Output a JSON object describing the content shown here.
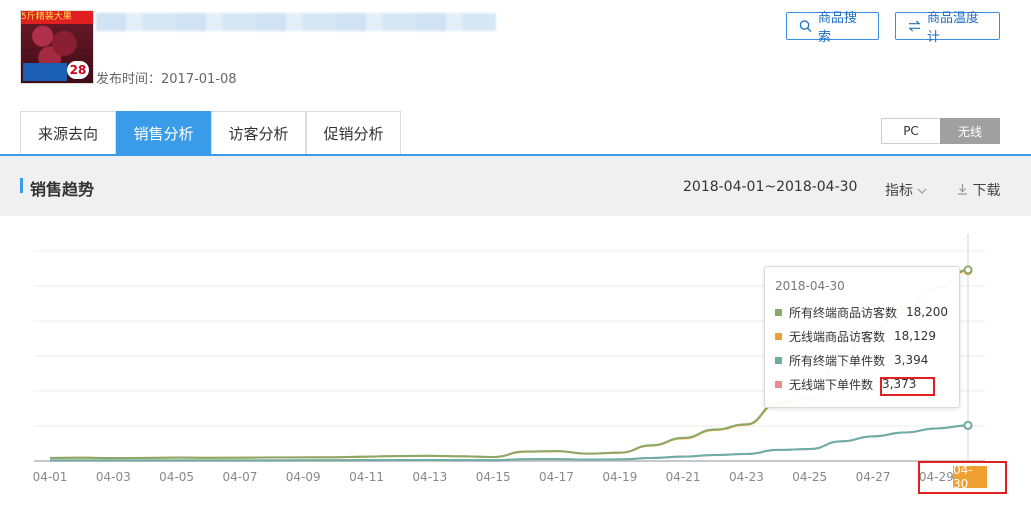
{
  "product": {
    "image_banner_text": "5斤精装大果",
    "image_price": "28",
    "published_label": "发布时间：",
    "published_date": "2017-01-08"
  },
  "toolbar": {
    "search_label": "商品搜索",
    "thermometer_label": "商品温度计"
  },
  "tabs": [
    {
      "label": "来源去向",
      "active": false
    },
    {
      "label": "销售分析",
      "active": true
    },
    {
      "label": "访客分析",
      "active": false
    },
    {
      "label": "促销分析",
      "active": false
    }
  ],
  "device_toggle": {
    "pc_label": "PC",
    "wireless_label": "无线",
    "selected": "无线"
  },
  "section": {
    "title": "销售趋势",
    "date_range": "2018-04-01~2018-04-30",
    "date_ghost": "",
    "metric_label": "指标",
    "download_label": "下载"
  },
  "chart_data": {
    "type": "line",
    "x": [
      "04-01",
      "04-02",
      "04-03",
      "04-04",
      "04-05",
      "04-06",
      "04-07",
      "04-08",
      "04-09",
      "04-10",
      "04-11",
      "04-12",
      "04-13",
      "04-14",
      "04-15",
      "04-16",
      "04-17",
      "04-18",
      "04-19",
      "04-20",
      "04-21",
      "04-22",
      "04-23",
      "04-24",
      "04-25",
      "04-26",
      "04-27",
      "04-28",
      "04-29",
      "04-30"
    ],
    "tick_labels": [
      "04-01",
      "04-03",
      "04-05",
      "04-07",
      "04-09",
      "04-11",
      "04-13",
      "04-15",
      "04-17",
      "04-19",
      "04-21",
      "04-23",
      "04-25",
      "04-27",
      "04-29",
      "04-30"
    ],
    "ylim": [
      0,
      20000
    ],
    "series": [
      {
        "name": "所有终端商品访客数",
        "color": "#8aa86a",
        "values": [
          300,
          320,
          280,
          300,
          330,
          310,
          320,
          340,
          350,
          360,
          420,
          480,
          500,
          450,
          380,
          900,
          950,
          700,
          800,
          1500,
          2200,
          3000,
          3500,
          5600,
          6000,
          10000,
          12500,
          14500,
          16500,
          18200
        ]
      },
      {
        "name": "无线端商品访客数",
        "color": "#f0a030",
        "values": [
          290,
          310,
          270,
          290,
          320,
          300,
          310,
          330,
          340,
          350,
          410,
          470,
          490,
          440,
          370,
          880,
          930,
          690,
          790,
          1470,
          2150,
          2950,
          3450,
          5500,
          5900,
          9900,
          12400,
          14400,
          16400,
          18129
        ]
      },
      {
        "name": "所有终端下单件数",
        "color": "#6aaea6",
        "values": [
          60,
          65,
          55,
          60,
          62,
          58,
          61,
          64,
          66,
          68,
          80,
          90,
          95,
          85,
          72,
          170,
          180,
          130,
          150,
          285,
          420,
          570,
          665,
          1060,
          1140,
          1880,
          2350,
          2720,
          3100,
          3394
        ]
      },
      {
        "name": "无线端下单件数",
        "color": "#e88c90",
        "values": [
          58,
          63,
          54,
          59,
          61,
          57,
          60,
          63,
          65,
          67,
          79,
          89,
          94,
          84,
          71,
          168,
          178,
          129,
          149,
          283,
          418,
          567,
          662,
          1055,
          1135,
          1870,
          2340,
          2710,
          3090,
          3373
        ]
      }
    ]
  },
  "tooltip": {
    "date": "2018-04-30",
    "rows": [
      {
        "label": "所有终端商品访客数",
        "value": "18,200",
        "color": "#8aa86a"
      },
      {
        "label": "无线端商品访客数",
        "value": "18,129",
        "color": "#f0a030"
      },
      {
        "label": "所有终端下单件数",
        "value": "3,394",
        "color": "#6aaea6"
      },
      {
        "label": "无线端下单件数",
        "value": "3,373",
        "color": "#e88c90"
      }
    ]
  },
  "highlight_end_label": "04-30"
}
